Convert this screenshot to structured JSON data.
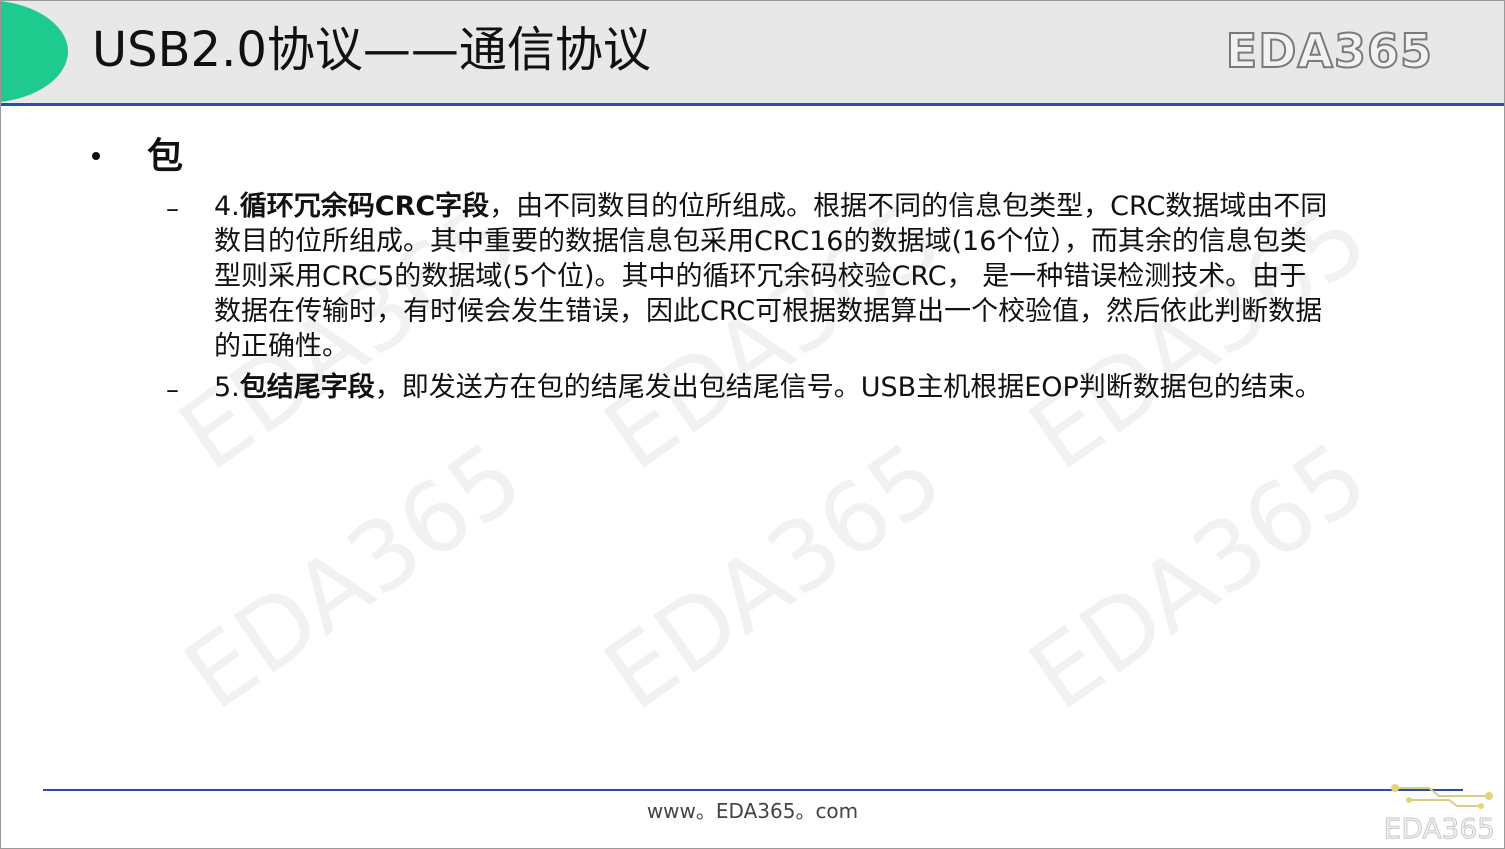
{
  "header": {
    "title": "USB2.0协议——通信协议",
    "logo_text": "EDA365",
    "accent_color": "#1fca8f",
    "rule_color": "#2b4fa8"
  },
  "watermark": {
    "text": "EDA365"
  },
  "content": {
    "bullet": "包",
    "items": [
      {
        "prefix": "4.",
        "bold": "循环冗余码CRC字段",
        "lines": [
          "，由不同数目的位所组成。根据不同的信息包类型，CRC数据域由不同",
          "数目的位所组成。其中重要的数据信息包采用CRC16的数据域(16个位），而其余的信息包类",
          "型则采用CRC5的数据域(5个位)。其中的循环冗余码校验CRC， 是一种错误检测技术。由于",
          "数据在传输时，有时候会发生错误，因此CRC可根据数据算出一个校验值，然后依此判断数据",
          "的正确性。"
        ]
      },
      {
        "prefix": "5.",
        "bold": "包结尾字段",
        "lines": [
          "，即发送方在包的结尾发出包结尾信号。USB主机根据EOP判断数据包的结束。"
        ]
      }
    ]
  },
  "footer": {
    "url": "www。EDA365。com",
    "corner_logo": "EDA365"
  }
}
